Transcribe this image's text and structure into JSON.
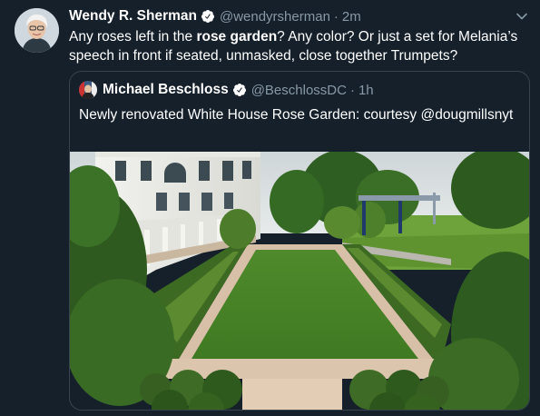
{
  "tweet": {
    "author_name": "Wendy R. Sherman",
    "handle": "@wendyrsherman",
    "separator": "·",
    "time": "2m",
    "text_part1": "Any roses left in the ",
    "text_bold": "rose garden",
    "text_part2": "? Any color? Or just a set for Melania’s speech in front if seated, unmasked, close together Trumpets?"
  },
  "quote": {
    "author_name": "Michael Beschloss",
    "handle": "@BeschlossDC",
    "separator": "·",
    "time": "1h",
    "text": "Newly renovated White House Rose Garden: courtesy @dougmillsnyt"
  },
  "icons": {
    "verified": "verified-badge-icon",
    "more": "chevron-down-icon"
  },
  "colors": {
    "background": "#15202b",
    "secondary_text": "#8899a6",
    "border": "#38444d",
    "verified": "#ffffff"
  }
}
